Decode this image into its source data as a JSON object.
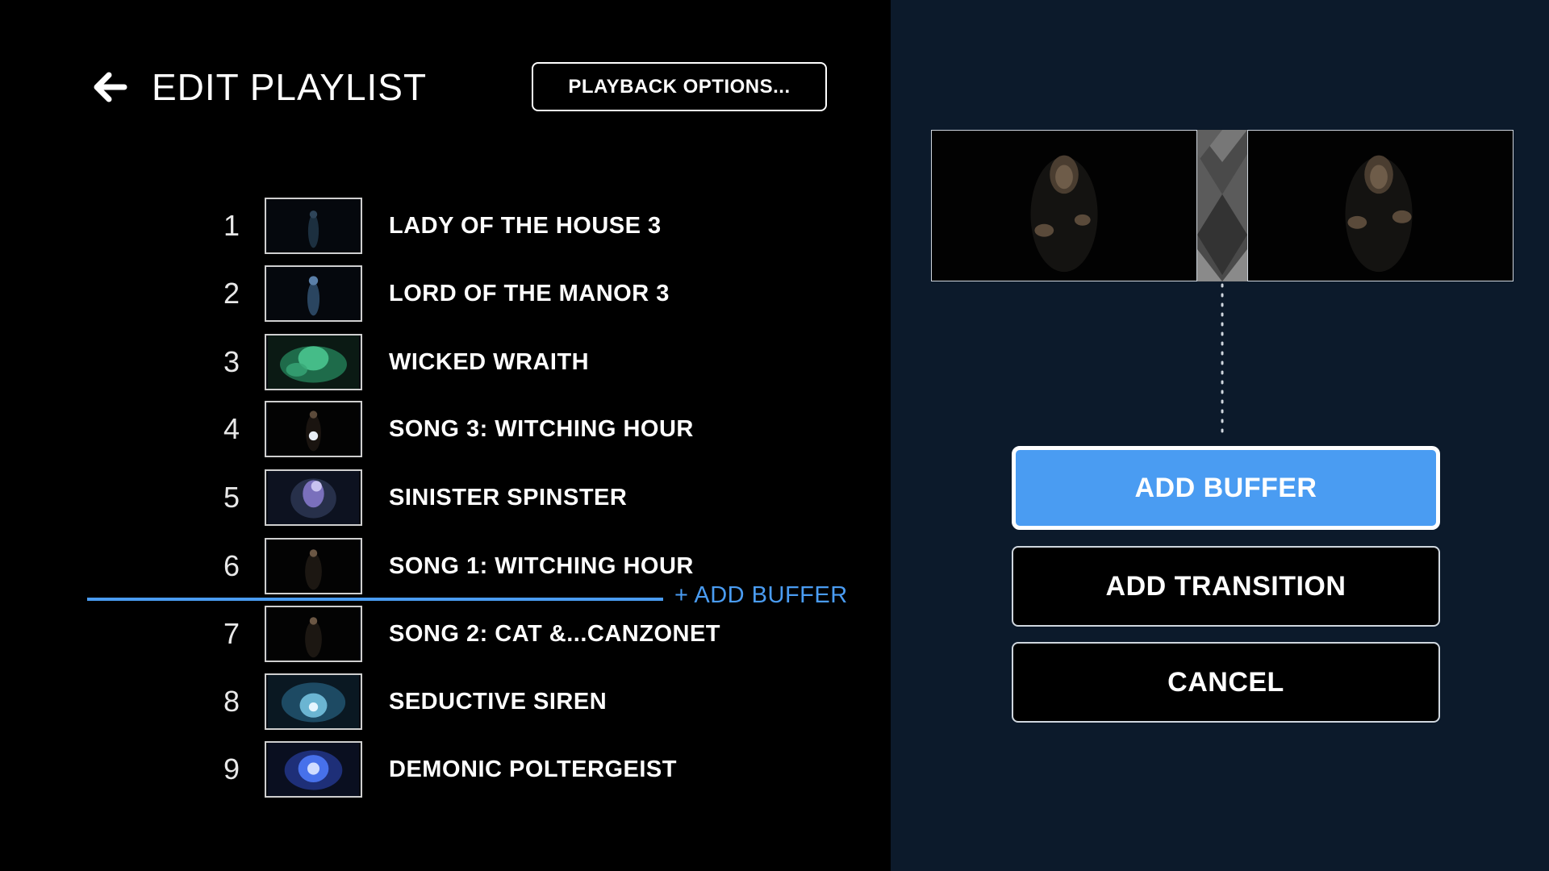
{
  "header": {
    "title": "EDIT PLAYLIST",
    "playback_options_label": "PLAYBACK OPTIONS..."
  },
  "playlist": [
    {
      "number": "1",
      "title": "LADY OF THE HOUSE 3"
    },
    {
      "number": "2",
      "title": "LORD OF THE MANOR 3"
    },
    {
      "number": "3",
      "title": "WICKED WRAITH"
    },
    {
      "number": "4",
      "title": "SONG 3: WITCHING HOUR"
    },
    {
      "number": "5",
      "title": "SINISTER SPINSTER"
    },
    {
      "number": "6",
      "title": "SONG 1: WITCHING HOUR"
    },
    {
      "number": "7",
      "title": "SONG 2: CAT &...CANZONET"
    },
    {
      "number": "8",
      "title": "SEDUCTIVE SIREN"
    },
    {
      "number": "9",
      "title": "DEMONIC POLTERGEIST"
    }
  ],
  "insert_point": {
    "label": "+ ADD BUFFER",
    "after_item": "6"
  },
  "menu": {
    "add_buffer": "ADD BUFFER",
    "add_transition": "ADD TRANSITION",
    "cancel": "CANCEL",
    "selected": "add_buffer"
  },
  "icons": {
    "back": "back-arrow-icon",
    "gap": "buffer-gap-icon"
  },
  "colors": {
    "accent": "#4a9cf2",
    "left_background": "#000000",
    "right_background": "#0c1a2b"
  }
}
